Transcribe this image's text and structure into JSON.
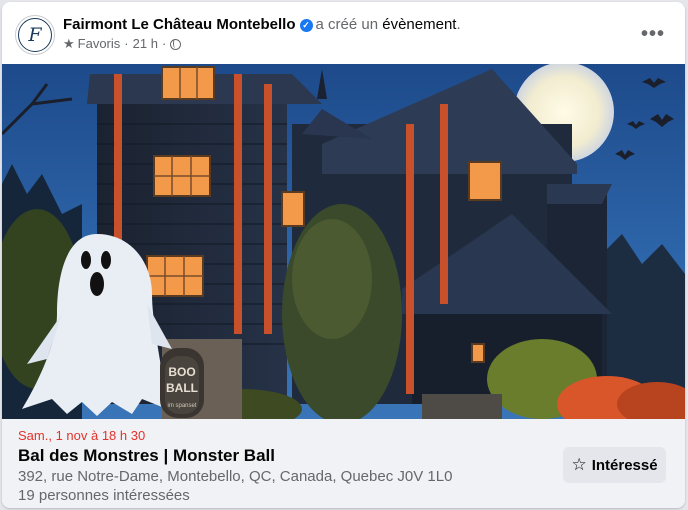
{
  "header": {
    "page_name": "Fairmont Le Château Montebello",
    "action_prefix": "a créé un",
    "action_object": "évènement",
    "action_suffix": ".",
    "audience_label": "Favoris",
    "time_ago": "21 h",
    "separator": "·",
    "avatar_letter": "F",
    "verified_icon": "verified-badge-icon",
    "more_icon": "more-options-icon"
  },
  "image": {
    "sign_line1": "BOO",
    "sign_line2": "BALL",
    "sign_line3": "im spanset"
  },
  "event": {
    "date": "Sam., 1 nov à 18 h 30",
    "title": "Bal des Monstres | Monster Ball",
    "address": "392, rue Notre-Dame, Montebello, QC, Canada, Quebec J0V 1L0",
    "interested_count": "19 personnes intéressées",
    "interest_button_label": "Intéressé"
  },
  "colors": {
    "date_red": "#e4322b",
    "verified_blue": "#1877f2"
  }
}
